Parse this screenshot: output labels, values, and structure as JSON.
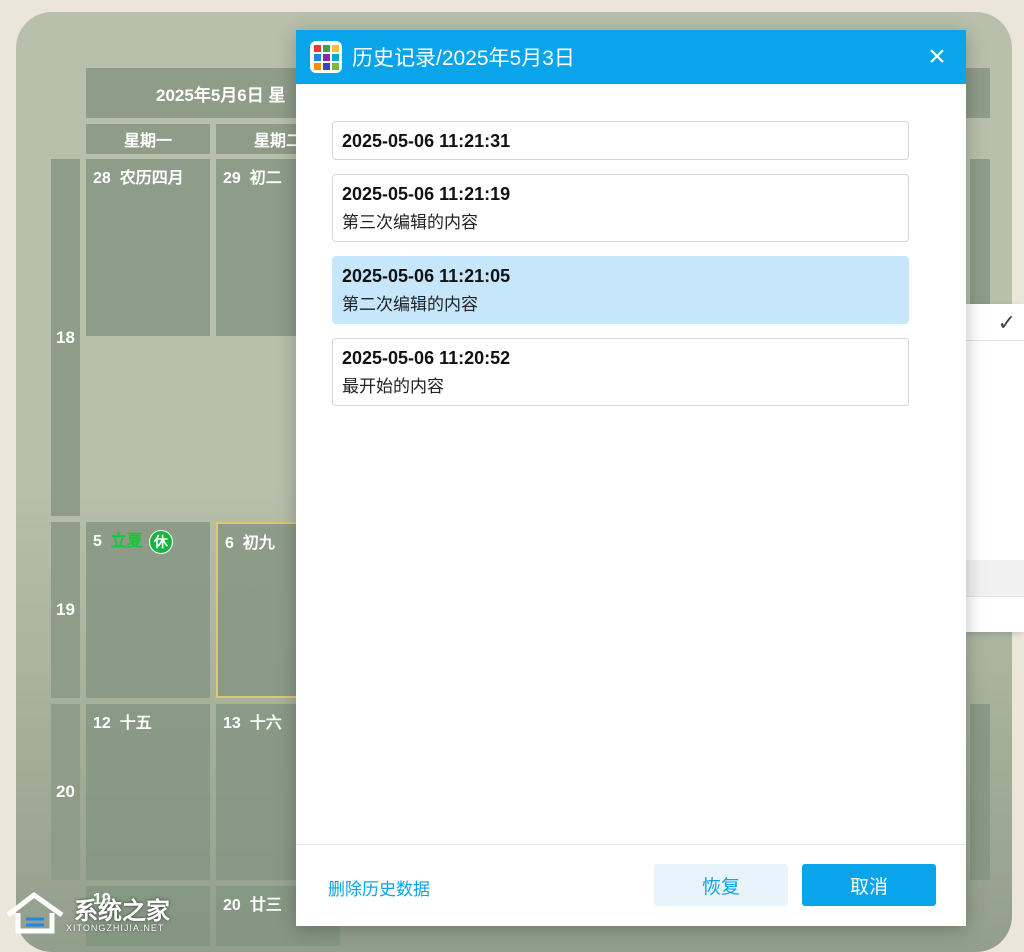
{
  "calendar": {
    "title": "2025年5月6日 星",
    "weekdays": [
      "星期一",
      "星期二"
    ],
    "weeks": [
      "18",
      "19",
      "20"
    ],
    "cells": [
      {
        "date": "28",
        "label": "农历四月"
      },
      {
        "date": "29",
        "label": "初二"
      },
      {
        "date": "5",
        "label": "立夏",
        "badge": "休"
      },
      {
        "date": "6",
        "label": "初九"
      },
      {
        "date": "12",
        "label": "十五"
      },
      {
        "date": "13",
        "label": "十六"
      },
      {
        "date": "19",
        "label": ""
      },
      {
        "date": "20",
        "label": "廿三"
      }
    ]
  },
  "dialog": {
    "title": "历史记录/2025年5月3日",
    "close_icon": "×",
    "history": [
      {
        "time": "2025-05-06 11:21:31",
        "desc": ""
      },
      {
        "time": "2025-05-06 11:21:19",
        "desc": "第三次编辑的内容"
      },
      {
        "time": "2025-05-06 11:21:05",
        "desc": "第二次编辑的内容",
        "selected": true
      },
      {
        "time": "2025-05-06 11:20:52",
        "desc": "最开始的内容"
      }
    ],
    "delete_link": "删除历史数据",
    "restore_label": "恢复",
    "cancel_label": "取消"
  },
  "side_menu": {
    "check_icon": "✓"
  },
  "watermark": {
    "text": "系统之家",
    "sub": "XITONGZHIJIA.NET"
  },
  "colors": {
    "accent": "#0aa4ea",
    "selected_row": "#c5e6fb",
    "solar_term": "#19c43a",
    "icon_tiles": [
      "#e53935",
      "#43a047",
      "#fbc02d",
      "#1e88e5",
      "#8e24aa",
      "#00acc1",
      "#fb8c00",
      "#3949ab",
      "#7cb342"
    ]
  }
}
